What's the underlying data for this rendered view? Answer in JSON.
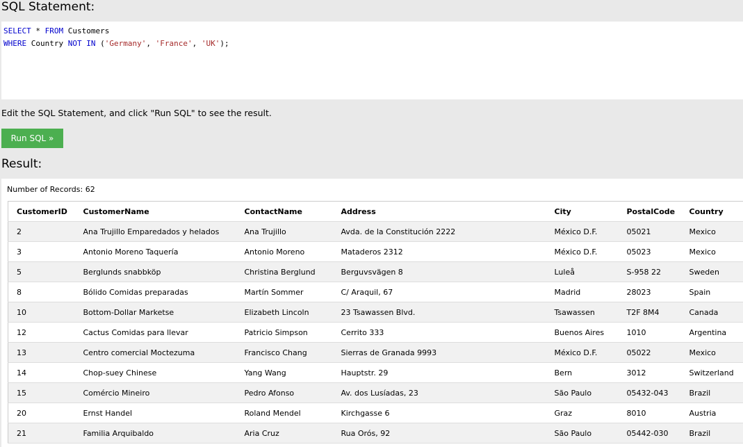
{
  "sql_section": {
    "title": "SQL Statement:",
    "line1": {
      "kw1": "SELECT",
      "rest1": " * ",
      "kw2": "FROM",
      "rest2": " Customers"
    },
    "line2": {
      "kw1": "WHERE",
      "rest1": " Country ",
      "kw2": "NOT IN",
      "rest2": " (",
      "s1": "'Germany'",
      "c1": ", ",
      "s2": "'France'",
      "c2": ", ",
      "s3": "'UK'",
      "end": ");"
    }
  },
  "hint": "Edit the SQL Statement, and click \"Run SQL\" to see the result.",
  "run_button": "Run SQL »",
  "result": {
    "title": "Result:",
    "records_label": "Number of Records: 62",
    "columns": [
      "CustomerID",
      "CustomerName",
      "ContactName",
      "Address",
      "City",
      "PostalCode",
      "Country"
    ],
    "rows": [
      [
        "2",
        "Ana Trujillo Emparedados y helados",
        "Ana Trujillo",
        "Avda. de la Constitución 2222",
        "México D.F.",
        "05021",
        "Mexico"
      ],
      [
        "3",
        "Antonio Moreno Taquería",
        "Antonio Moreno",
        "Mataderos 2312",
        "México D.F.",
        "05023",
        "Mexico"
      ],
      [
        "5",
        "Berglunds snabbköp",
        "Christina Berglund",
        "Berguvsvägen 8",
        "Luleå",
        "S-958 22",
        "Sweden"
      ],
      [
        "8",
        "Bólido Comidas preparadas",
        "Martín Sommer",
        "C/ Araquil, 67",
        "Madrid",
        "28023",
        "Spain"
      ],
      [
        "10",
        "Bottom-Dollar Marketse",
        "Elizabeth Lincoln",
        "23 Tsawassen Blvd.",
        "Tsawassen",
        "T2F 8M4",
        "Canada"
      ],
      [
        "12",
        "Cactus Comidas para llevar",
        "Patricio Simpson",
        "Cerrito 333",
        "Buenos Aires",
        "1010",
        "Argentina"
      ],
      [
        "13",
        "Centro comercial Moctezuma",
        "Francisco Chang",
        "Sierras de Granada 9993",
        "México D.F.",
        "05022",
        "Mexico"
      ],
      [
        "14",
        "Chop-suey Chinese",
        "Yang Wang",
        "Hauptstr. 29",
        "Bern",
        "3012",
        "Switzerland"
      ],
      [
        "15",
        "Comércio Mineiro",
        "Pedro Afonso",
        "Av. dos Lusíadas, 23",
        "São Paulo",
        "05432-043",
        "Brazil"
      ],
      [
        "20",
        "Ernst Handel",
        "Roland Mendel",
        "Kirchgasse 6",
        "Graz",
        "8010",
        "Austria"
      ],
      [
        "21",
        "Familia Arquibaldo",
        "Aria Cruz",
        "Rua Orós, 92",
        "São Paulo",
        "05442-030",
        "Brazil"
      ]
    ]
  }
}
